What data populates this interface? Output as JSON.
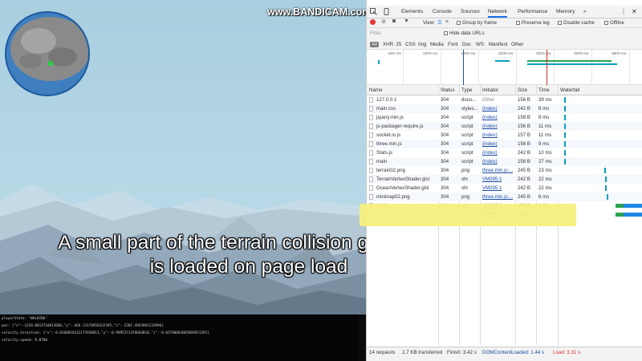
{
  "watermark": "www.BANDICAM.com",
  "caption": {
    "line1": "A small part of the  terrain collision geometry",
    "line2": "is loaded on page load"
  },
  "console": {
    "lines": [
      "playerState: \"WALKING\"",
      "pos: {\"x\":-1220.0013734813666,\"y\":-466.13170956332395,\"z\":-5205.4963962133996}",
      "velocity.direction: {\"x\":-0.0160016212173938011,\"y\":-0.9995371359664018,\"z\":-0.02790003065869651291}",
      "velocity.speed: 0.0700"
    ]
  },
  "devtools": {
    "tabs": [
      "Elements",
      "Console",
      "Sources",
      "Network",
      "Performance",
      "Memory",
      "»"
    ],
    "active_tab": "Network",
    "toolbar": {
      "view_label": "View:",
      "group_by_frame": "Group by frame",
      "preserve_log": "Preserve log",
      "disable_cache": "Disable cache",
      "offline": "Offline"
    },
    "filter": {
      "placeholder": "Filter",
      "hide_data_urls": "Hide data URLs",
      "types": [
        "All",
        "XHR",
        "JS",
        "CSS",
        "Img",
        "Media",
        "Font",
        "Doc",
        "WS",
        "Manifest",
        "Other"
      ]
    },
    "overview_ticks": [
      "500 ms",
      "1000 ms",
      "1500 ms",
      "2000 ms",
      "2500 ms",
      "3000 ms",
      "3500 ms"
    ],
    "columns": [
      "Name",
      "Status",
      "Type",
      "Initiator",
      "Size",
      "Time",
      "Waterfall"
    ],
    "requests": [
      {
        "name": "127.0.0.1",
        "status": "304",
        "type": "docu...",
        "initiator": "Other",
        "size": "156 B",
        "time": "39 ms"
      },
      {
        "name": "main.css",
        "status": "304",
        "type": "styles...",
        "initiator": "(index)",
        "size": "242 B",
        "time": "8 ms"
      },
      {
        "name": "jquery.min.js",
        "status": "304",
        "type": "script",
        "initiator": "(index)",
        "size": "158 B",
        "time": "8 ms"
      },
      {
        "name": "js-packager-require.js",
        "status": "304",
        "type": "script",
        "initiator": "(index)",
        "size": "156 B",
        "time": "11 ms"
      },
      {
        "name": "socket.io.js",
        "status": "304",
        "type": "script",
        "initiator": "(index)",
        "size": "157 B",
        "time": "11 ms"
      },
      {
        "name": "three.min.js",
        "status": "304",
        "type": "script",
        "initiator": "(index)",
        "size": "158 B",
        "time": "9 ms"
      },
      {
        "name": "Stats.js",
        "status": "304",
        "type": "script",
        "initiator": "(index)",
        "size": "242 B",
        "time": "10 ms"
      },
      {
        "name": "main",
        "status": "304",
        "type": "script",
        "initiator": "(index)",
        "size": "158 B",
        "time": "27 ms"
      },
      {
        "name": "terrain02.png",
        "status": "304",
        "type": "png",
        "initiator": "three.min.js:...",
        "size": "245 B",
        "time": "23 ms"
      },
      {
        "name": "TerrainVertexShader.glsl",
        "status": "304",
        "type": "xhr",
        "initiator": "VM295:1",
        "size": "242 B",
        "time": "22 ms"
      },
      {
        "name": "OceanVertexShader.glsl",
        "status": "304",
        "type": "xhr",
        "initiator": "VM295:1",
        "size": "242 B",
        "time": "22 ms"
      },
      {
        "name": "minimap02.png",
        "status": "304",
        "type": "png",
        "initiator": "three.min.js:...",
        "size": "245 B",
        "time": "6 ms"
      },
      {
        "name": "2048",
        "status": "304",
        "type": "xhr",
        "initiator": "VM295:1",
        "size": "159 B",
        "time": "1.10 s"
      },
      {
        "name": "2048",
        "status": "304",
        "type": "xhr",
        "initiator": "VM295:1",
        "size": "159 B",
        "time": "1.19 s"
      }
    ],
    "status": {
      "requests": "14 requests",
      "transferred": "2.7 KB transferred",
      "finish": "Finish: 3.42 s",
      "dcl": "DOMContentLoaded: 1.44 s",
      "load": "Load: 3.31 s"
    },
    "colors": {
      "accent": "#1a73e8",
      "record": "#e53935",
      "dcl": "#1a4ca3",
      "load": "#d32f2f",
      "highlight": "#f6f07c"
    }
  }
}
